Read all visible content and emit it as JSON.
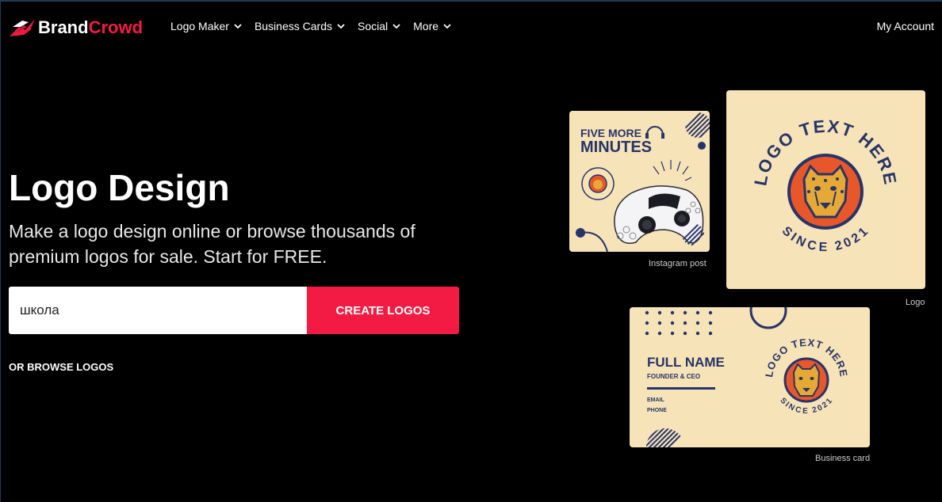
{
  "brand": {
    "part1": "Brand",
    "part2": "Crowd"
  },
  "nav": {
    "items": [
      {
        "label": "Logo Maker"
      },
      {
        "label": "Business Cards"
      },
      {
        "label": "Social"
      },
      {
        "label": "More"
      }
    ],
    "account": "My Account"
  },
  "hero": {
    "title": "Logo Design",
    "subtitle": "Make a logo design online or browse thousands of premium logos for sale. Start for FREE.",
    "search_value": "школа",
    "create_button": "CREATE LOGOS",
    "browse_link": "OR BROWSE LOGOS"
  },
  "previews": {
    "instagram": {
      "caption": "Instagram post",
      "line1": "FIVE MORE",
      "line2": "MINUTES"
    },
    "logo": {
      "caption": "Logo",
      "arc_top": "LOGO TEXT HERE",
      "arc_bottom": "SINCE 2021"
    },
    "business_card": {
      "caption": "Business card",
      "name": "FULL NAME",
      "role": "FOUNDER & CEO",
      "email": "EMAIL",
      "phone": "PHONE"
    }
  },
  "colors": {
    "accent": "#f31b43",
    "navy": "#283469",
    "cream": "#f6e3b7",
    "orange": "#e8572a",
    "background": "#000000"
  }
}
